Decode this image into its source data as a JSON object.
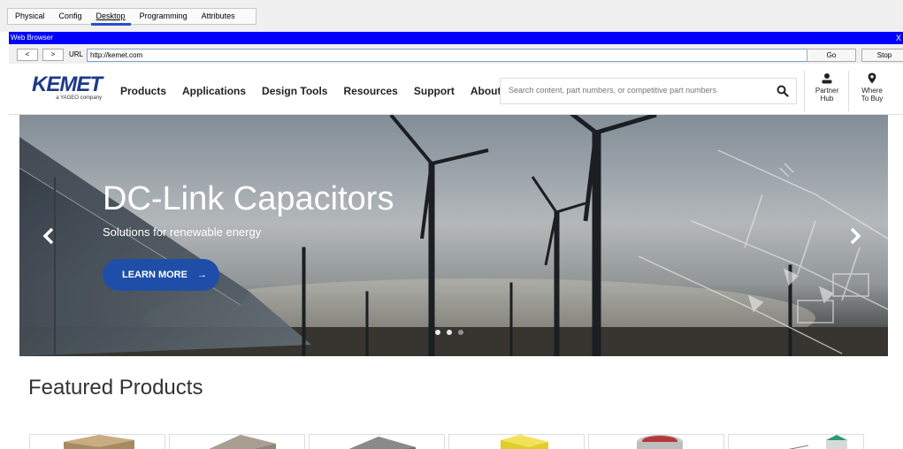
{
  "tabs": [
    "Physical",
    "Config",
    "Desktop",
    "Programming",
    "Attributes"
  ],
  "active_tab": "Desktop",
  "browser": {
    "title": "Web Browser",
    "close": "X",
    "back": "<",
    "forward": ">",
    "url_label": "URL",
    "url": "http://kemet.com",
    "go": "Go",
    "stop": "Stop"
  },
  "site": {
    "logo": "KEMET",
    "logo_sub": "a YAGEO company",
    "nav": [
      "Products",
      "Applications",
      "Design Tools",
      "Resources",
      "Support",
      "About"
    ],
    "search_placeholder": "Search content, part numbers, or competitive part numbers",
    "partner_hub": [
      "Partner",
      "Hub"
    ],
    "where_to_buy": [
      "Where",
      "To Buy"
    ]
  },
  "hero": {
    "title": "DC-Link Capacitors",
    "subtitle": "Solutions for renewable energy",
    "cta": "LEARN MORE",
    "cta_arrow": "→",
    "prev": "‹",
    "next": "›",
    "slides": 3,
    "active_slide": 1
  },
  "featured": {
    "title": "Featured Products"
  },
  "colors": {
    "brand": "#1c3a8a",
    "cta": "#1f4ea8",
    "titlebar": "#0000ff"
  }
}
